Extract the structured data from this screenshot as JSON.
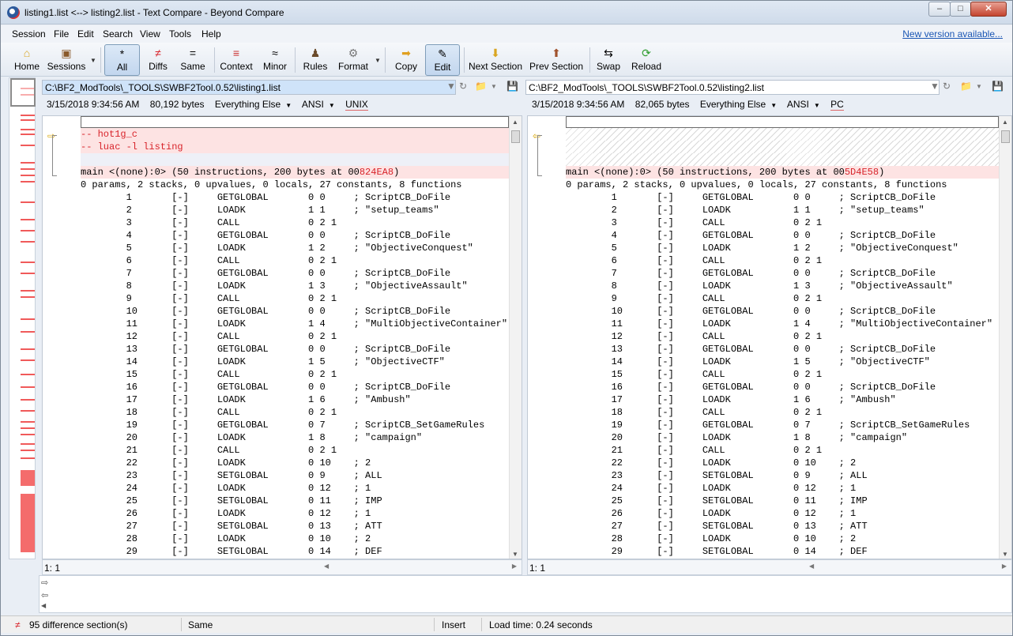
{
  "window": {
    "title": "listing1.list <--> listing2.list - Text Compare - Beyond Compare"
  },
  "menu": [
    "Session",
    "File",
    "Edit",
    "Search",
    "View",
    "Tools",
    "Help"
  ],
  "new_version": "New version available...",
  "toolbar": [
    {
      "label": "Home",
      "icon": "home-icon"
    },
    {
      "label": "Sessions",
      "icon": "sessions-icon"
    },
    {
      "label": "All",
      "icon": "all-icon",
      "active": true
    },
    {
      "label": "Diffs",
      "icon": "diffs-icon"
    },
    {
      "label": "Same",
      "icon": "same-icon"
    },
    {
      "label": "Context",
      "icon": "context-icon"
    },
    {
      "label": "Minor",
      "icon": "minor-icon"
    },
    {
      "label": "Rules",
      "icon": "rules-icon"
    },
    {
      "label": "Format",
      "icon": "format-icon"
    },
    {
      "label": "Copy",
      "icon": "copy-icon"
    },
    {
      "label": "Edit",
      "icon": "edit-icon",
      "active": true
    },
    {
      "label": "Next Section",
      "icon": "down-arrow-icon"
    },
    {
      "label": "Prev Section",
      "icon": "up-arrow-icon"
    },
    {
      "label": "Swap",
      "icon": "swap-icon"
    },
    {
      "label": "Reload",
      "icon": "reload-icon"
    }
  ],
  "left": {
    "path": "C:\\BF2_ModTools\\_TOOLS\\SWBF2Tool.0.52\\listing1.list",
    "date": "3/15/2018 9:34:56 AM",
    "size": "80,192 bytes",
    "format": "Everything Else",
    "encoding": "ANSI",
    "lineend": "UNIX",
    "position": "1: 1"
  },
  "right": {
    "path": "C:\\BF2_ModTools\\_TOOLS\\SWBF2Tool.0.52\\listing2.list",
    "date": "3/15/2018 9:34:56 AM",
    "size": "82,065 bytes",
    "format": "Everything Else",
    "encoding": "ANSI",
    "lineend": "PC",
    "position": "1: 1"
  },
  "left_lines": [
    {
      "n": "1",
      "t": "",
      "cls": "cursor"
    },
    {
      "n": "2",
      "t": "-- hot1g_c",
      "cls": "diff"
    },
    {
      "n": "3",
      "t": "-- luac -l listing",
      "cls": "diff"
    },
    {
      "n": "4",
      "t": "",
      "cls": "empty"
    },
    {
      "n": "5",
      "t": "main <(none):0> (50 instructions, 200 bytes at 00",
      "hl": "824EA8",
      "t2": ")",
      "cls": "diff2"
    },
    {
      "n": "6",
      "t": "0 params, 2 stacks, 0 upvalues, 0 locals, 27 constants, 8 functions"
    },
    {
      "n": "7",
      "t": "        1       [-]     GETGLOBAL       0 0     ; ScriptCB_DoFile"
    },
    {
      "n": "8",
      "t": "        2       [-]     LOADK           1 1     ; \"setup_teams\""
    },
    {
      "n": "9",
      "t": "        3       [-]     CALL            0 2 1"
    },
    {
      "n": "10",
      "t": "        4       [-]     GETGLOBAL       0 0     ; ScriptCB_DoFile"
    },
    {
      "n": "11",
      "t": "        5       [-]     LOADK           1 2     ; \"ObjectiveConquest\""
    },
    {
      "n": "12",
      "t": "        6       [-]     CALL            0 2 1"
    },
    {
      "n": "13",
      "t": "        7       [-]     GETGLOBAL       0 0     ; ScriptCB_DoFile"
    },
    {
      "n": "14",
      "t": "        8       [-]     LOADK           1 3     ; \"ObjectiveAssault\""
    },
    {
      "n": "15",
      "t": "        9       [-]     CALL            0 2 1"
    },
    {
      "n": "16",
      "t": "        10      [-]     GETGLOBAL       0 0     ; ScriptCB_DoFile"
    },
    {
      "n": "17",
      "t": "        11      [-]     LOADK           1 4     ; \"MultiObjectiveContainer\""
    },
    {
      "n": "18",
      "t": "        12      [-]     CALL            0 2 1"
    },
    {
      "n": "19",
      "t": "        13      [-]     GETGLOBAL       0 0     ; ScriptCB_DoFile"
    },
    {
      "n": "20",
      "t": "        14      [-]     LOADK           1 5     ; \"ObjectiveCTF\""
    },
    {
      "n": "21",
      "t": "        15      [-]     CALL            0 2 1"
    },
    {
      "n": "22",
      "t": "        16      [-]     GETGLOBAL       0 0     ; ScriptCB_DoFile"
    },
    {
      "n": "23",
      "t": "        17      [-]     LOADK           1 6     ; \"Ambush\""
    },
    {
      "n": "24",
      "t": "        18      [-]     CALL            0 2 1"
    },
    {
      "n": "25",
      "t": "        19      [-]     GETGLOBAL       0 7     ; ScriptCB_SetGameRules"
    },
    {
      "n": "26",
      "t": "        20      [-]     LOADK           1 8     ; \"campaign\""
    },
    {
      "n": "27",
      "t": "        21      [-]     CALL            0 2 1"
    },
    {
      "n": "28",
      "t": "        22      [-]     LOADK           0 10    ; 2"
    },
    {
      "n": "29",
      "t": "        23      [-]     SETGLOBAL       0 9     ; ALL"
    },
    {
      "n": "30",
      "t": "        24      [-]     LOADK           0 12    ; 1"
    },
    {
      "n": "31",
      "t": "        25      [-]     SETGLOBAL       0 11    ; IMP"
    },
    {
      "n": "32",
      "t": "        26      [-]     LOADK           0 12    ; 1"
    },
    {
      "n": "33",
      "t": "        27      [-]     SETGLOBAL       0 13    ; ATT"
    },
    {
      "n": "34",
      "t": "        28      [-]     LOADK           0 10    ; 2"
    },
    {
      "n": "35",
      "t": "        29      [-]     SETGLOBAL       0 14    ; DEF"
    }
  ],
  "right_lines": [
    {
      "n": "1",
      "t": "",
      "cls": "cursor"
    },
    {
      "n": "",
      "t": "",
      "cls": "gap"
    },
    {
      "n": "",
      "t": "",
      "cls": "gap"
    },
    {
      "n": "",
      "t": "",
      "cls": "gap"
    },
    {
      "n": "2",
      "t": "main <(none):0> (50 instructions, 200 bytes at 00",
      "hl": "5D4E58",
      "t2": ")",
      "cls": "diff2"
    },
    {
      "n": "3",
      "t": "0 params, 2 stacks, 0 upvalues, 0 locals, 27 constants, 8 functions"
    },
    {
      "n": "4",
      "t": "        1       [-]     GETGLOBAL       0 0     ; ScriptCB_DoFile"
    },
    {
      "n": "5",
      "t": "        2       [-]     LOADK           1 1     ; \"setup_teams\""
    },
    {
      "n": "6",
      "t": "        3       [-]     CALL            0 2 1"
    },
    {
      "n": "7",
      "t": "        4       [-]     GETGLOBAL       0 0     ; ScriptCB_DoFile"
    },
    {
      "n": "8",
      "t": "        5       [-]     LOADK           1 2     ; \"ObjectiveConquest\""
    },
    {
      "n": "9",
      "t": "        6       [-]     CALL            0 2 1"
    },
    {
      "n": "10",
      "t": "        7       [-]     GETGLOBAL       0 0     ; ScriptCB_DoFile"
    },
    {
      "n": "11",
      "t": "        8       [-]     LOADK           1 3     ; \"ObjectiveAssault\""
    },
    {
      "n": "12",
      "t": "        9       [-]     CALL            0 2 1"
    },
    {
      "n": "13",
      "t": "        10      [-]     GETGLOBAL       0 0     ; ScriptCB_DoFile"
    },
    {
      "n": "14",
      "t": "        11      [-]     LOADK           1 4     ; \"MultiObjectiveContainer\""
    },
    {
      "n": "15",
      "t": "        12      [-]     CALL            0 2 1"
    },
    {
      "n": "16",
      "t": "        13      [-]     GETGLOBAL       0 0     ; ScriptCB_DoFile"
    },
    {
      "n": "17",
      "t": "        14      [-]     LOADK           1 5     ; \"ObjectiveCTF\""
    },
    {
      "n": "18",
      "t": "        15      [-]     CALL            0 2 1"
    },
    {
      "n": "19",
      "t": "        16      [-]     GETGLOBAL       0 0     ; ScriptCB_DoFile"
    },
    {
      "n": "20",
      "t": "        17      [-]     LOADK           1 6     ; \"Ambush\""
    },
    {
      "n": "21",
      "t": "        18      [-]     CALL            0 2 1"
    },
    {
      "n": "22",
      "t": "        19      [-]     GETGLOBAL       0 7     ; ScriptCB_SetGameRules"
    },
    {
      "n": "23",
      "t": "        20      [-]     LOADK           1 8     ; \"campaign\""
    },
    {
      "n": "24",
      "t": "        21      [-]     CALL            0 2 1"
    },
    {
      "n": "25",
      "t": "        22      [-]     LOADK           0 10    ; 2"
    },
    {
      "n": "26",
      "t": "        23      [-]     SETGLOBAL       0 9     ; ALL"
    },
    {
      "n": "27",
      "t": "        24      [-]     LOADK           0 12    ; 1"
    },
    {
      "n": "28",
      "t": "        25      [-]     SETGLOBAL       0 11    ; IMP"
    },
    {
      "n": "29",
      "t": "        26      [-]     LOADK           0 12    ; 1"
    },
    {
      "n": "30",
      "t": "        27      [-]     SETGLOBAL       0 13    ; ATT"
    },
    {
      "n": "31",
      "t": "        28      [-]     LOADK           0 10    ; 2"
    },
    {
      "n": "32",
      "t": "        29      [-]     SETGLOBAL       0 14    ; DEF"
    }
  ],
  "status": {
    "differences": "95 difference section(s)",
    "same": "Same",
    "mode": "Insert",
    "load": "Load time: 0.24 seconds"
  },
  "colors": {
    "diff_bg": "#fde3e3",
    "diff_text": "#d8232a",
    "accent": "#1a56b4"
  }
}
